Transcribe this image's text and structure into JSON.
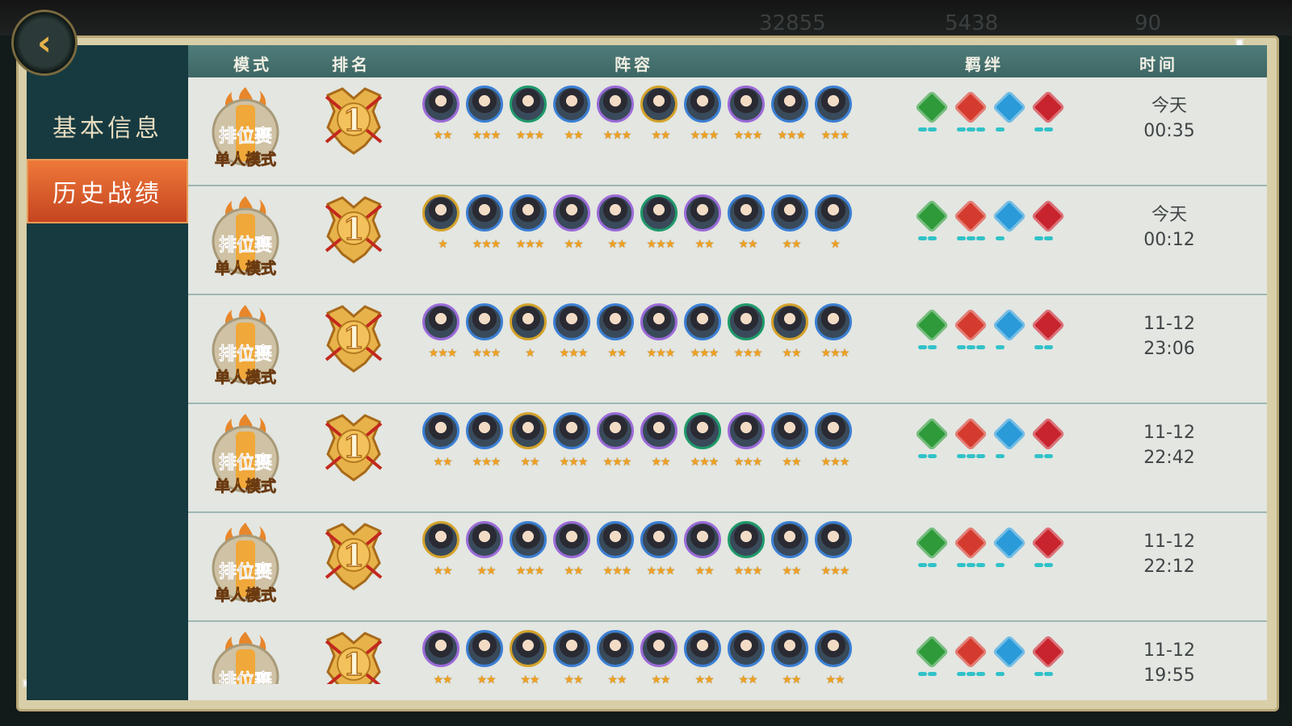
{
  "top_resources": [
    "32855",
    "5438",
    "90"
  ],
  "sidebar": {
    "back_label": "‹",
    "tabs": [
      {
        "label": "基本信息",
        "active": false
      },
      {
        "label": "历史战绩",
        "active": true
      }
    ]
  },
  "table": {
    "columns": [
      "模式",
      "排名",
      "阵容",
      "羁绊",
      "时间"
    ],
    "mode_title": "排位赛",
    "mode_sub": "单人模式",
    "rows": [
      {
        "rank": "1",
        "stars": [
          2,
          3,
          3,
          2,
          3,
          2,
          3,
          3,
          3,
          3
        ],
        "frames": [
          "purple",
          "blue",
          "green",
          "blue",
          "purple",
          "gold",
          "blue",
          "purple",
          "blue",
          "blue"
        ],
        "bond_levels": [
          2,
          3,
          1,
          2
        ],
        "time_day": "今天",
        "time_clock": "00:35"
      },
      {
        "rank": "1",
        "stars": [
          1,
          3,
          3,
          2,
          2,
          3,
          2,
          2,
          2,
          1
        ],
        "frames": [
          "gold",
          "blue",
          "blue",
          "purple",
          "purple",
          "green",
          "purple",
          "blue",
          "blue",
          "blue"
        ],
        "bond_levels": [
          2,
          3,
          1,
          2
        ],
        "time_day": "今天",
        "time_clock": "00:12"
      },
      {
        "rank": "1",
        "stars": [
          3,
          3,
          1,
          3,
          2,
          3,
          3,
          3,
          2,
          3
        ],
        "frames": [
          "purple",
          "blue",
          "gold",
          "blue",
          "blue",
          "purple",
          "blue",
          "green",
          "gold",
          "blue"
        ],
        "bond_levels": [
          2,
          3,
          1,
          2
        ],
        "time_day": "11-12",
        "time_clock": "23:06"
      },
      {
        "rank": "1",
        "stars": [
          2,
          3,
          2,
          3,
          3,
          2,
          3,
          3,
          2,
          3
        ],
        "frames": [
          "blue",
          "blue",
          "gold",
          "blue",
          "purple",
          "purple",
          "green",
          "purple",
          "blue",
          "blue"
        ],
        "bond_levels": [
          2,
          3,
          1,
          2
        ],
        "time_day": "11-12",
        "time_clock": "22:42"
      },
      {
        "rank": "1",
        "stars": [
          2,
          2,
          3,
          2,
          3,
          3,
          2,
          3,
          2,
          3
        ],
        "frames": [
          "gold",
          "purple",
          "blue",
          "purple",
          "blue",
          "blue",
          "purple",
          "green",
          "blue",
          "blue"
        ],
        "bond_levels": [
          2,
          3,
          1,
          2
        ],
        "time_day": "11-12",
        "time_clock": "22:12"
      },
      {
        "rank": "1",
        "stars": [
          2,
          2,
          2,
          2,
          2,
          2,
          2,
          2,
          2,
          2
        ],
        "frames": [
          "purple",
          "blue",
          "gold",
          "blue",
          "blue",
          "purple",
          "blue",
          "blue",
          "blue",
          "blue"
        ],
        "bond_levels": [
          2,
          3,
          1,
          2
        ],
        "time_day": "11-12",
        "time_clock": "19:55"
      }
    ]
  },
  "colors": {
    "purple": "#9b6ad8",
    "blue": "#3b7fd4",
    "green": "#1f9a6a",
    "gold": "#d4a22a",
    "bond_green": "#2e9a3a",
    "bond_red": "#d43b2e",
    "bond_blue": "#2a9ad8",
    "bond_crimson": "#c8242e",
    "bar_teal": "#30c2c8"
  }
}
